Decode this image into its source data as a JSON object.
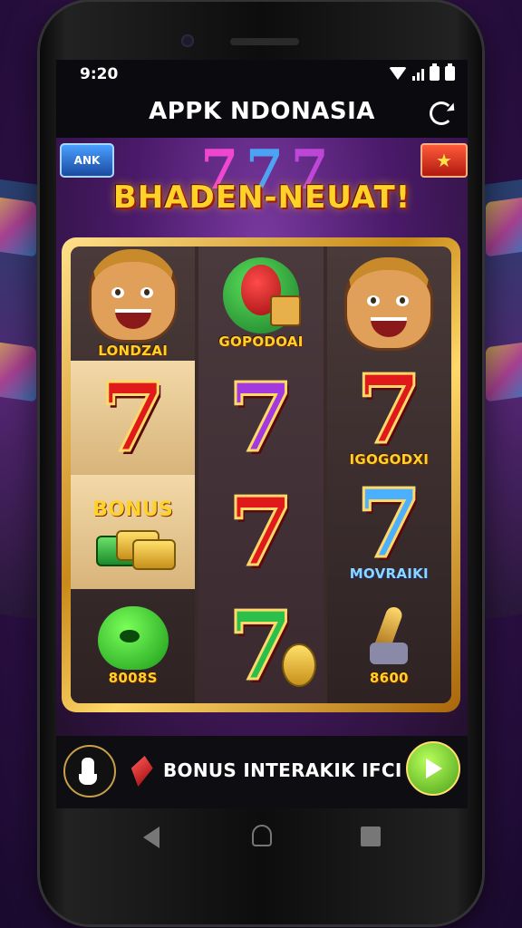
{
  "status_bar": {
    "time": "9:20",
    "icons": [
      "wifi-icon",
      "signal-icon",
      "battery-icon",
      "battery-icon"
    ]
  },
  "app_bar": {
    "title": "APPK NDONASIA",
    "refresh_icon": "refresh-icon"
  },
  "game": {
    "top_left_button": "ANK",
    "top_right_icon": "star-icon",
    "deco_sevens": [
      "7",
      "7",
      "7"
    ],
    "banner": "BHADEN-NEUAT!",
    "reels": [
      {
        "cells": [
          {
            "symbol": "character-face",
            "label": "LONDZAI"
          },
          {
            "symbol": "seven-red",
            "glyph": "7",
            "label": ""
          },
          {
            "symbol": "cash-stack",
            "label": "BONUS"
          },
          {
            "symbol": "green-blob",
            "label": "8008S"
          }
        ]
      },
      {
        "cells": [
          {
            "symbol": "fruit",
            "label": "GOPODOAI"
          },
          {
            "symbol": "seven-purple",
            "glyph": "7",
            "label": ""
          },
          {
            "symbol": "seven-red",
            "glyph": "7",
            "label": ""
          },
          {
            "symbol": "seven-green",
            "glyph": "7",
            "label": ""
          }
        ]
      },
      {
        "cells": [
          {
            "symbol": "character-face",
            "label": ""
          },
          {
            "symbol": "seven-red",
            "glyph": "7",
            "label": "IGOGODXI"
          },
          {
            "symbol": "seven-cyan",
            "glyph": "7",
            "label": "MOVRAIKI"
          },
          {
            "symbol": "rocket",
            "label": "8600"
          }
        ]
      }
    ]
  },
  "bottom_bar": {
    "left_icon": "hand-icon",
    "gem_icon": "gem-icon",
    "bonus_text": "BONUS INTERAKIK IFCI",
    "go_icon": "play-icon"
  },
  "nav_bar": {
    "icons": [
      "back-icon",
      "home-icon",
      "recent-apps-icon"
    ]
  }
}
